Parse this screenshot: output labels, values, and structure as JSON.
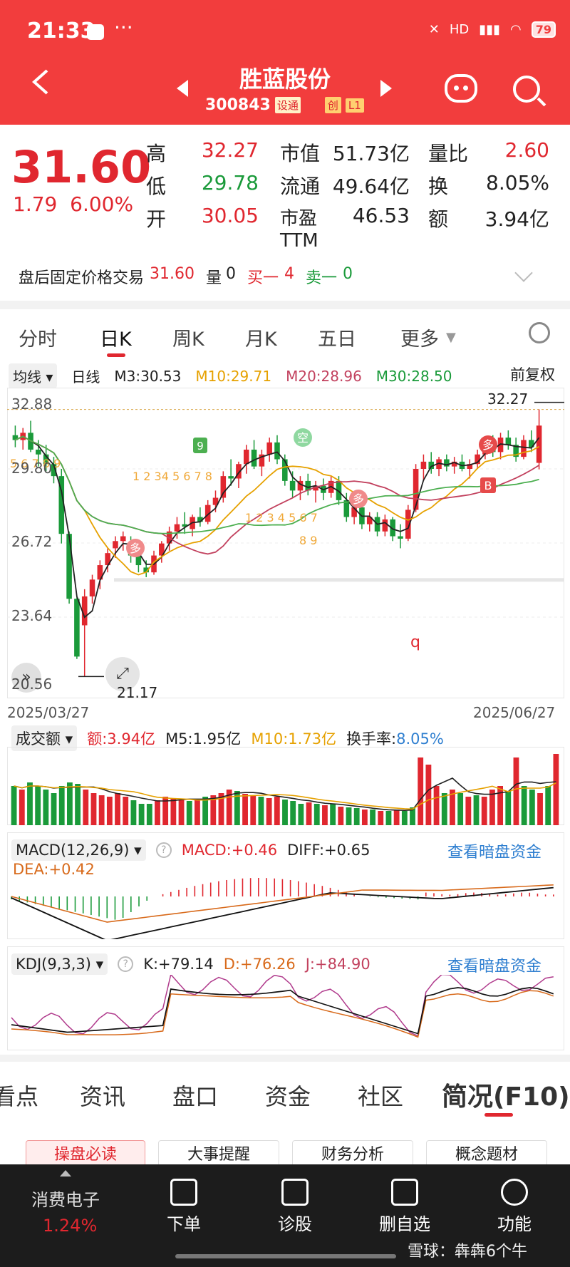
{
  "status_bar": {
    "time": "21:33",
    "dots": "···",
    "network": "HD",
    "battery": "79"
  },
  "header": {
    "stock_name": "胜蓝股份",
    "code": "300843",
    "tag1": "设通",
    "tag2": "创",
    "tag3": "L1"
  },
  "quote": {
    "price": "31.60",
    "change": "1.79",
    "change_pct": "6.00%",
    "rows": [
      {
        "l1": "高",
        "v1": "32.27",
        "l2": "市值",
        "v2": "51.73亿",
        "l3": "量比",
        "v3": "2.60"
      },
      {
        "l1": "低",
        "v1": "29.78",
        "l2": "流通",
        "v2": "49.64亿",
        "l3": "换",
        "v3": "8.05%"
      },
      {
        "l1": "开",
        "v1": "30.05",
        "l2": "市盈TTM",
        "v2": "46.53",
        "l3": "额",
        "v3": "3.94亿"
      }
    ],
    "after_hours": {
      "label": "盘后固定价格交易",
      "price": "31.60",
      "vol_label": "量",
      "vol": "0",
      "buy_label": "买一",
      "buy": "4",
      "sell_label": "卖一",
      "sell": "0"
    }
  },
  "chart_tabs": [
    "分时",
    "日K",
    "周K",
    "月K",
    "五日",
    "更多"
  ],
  "ma": {
    "chip": "均线",
    "type": "日线",
    "m3": "M3:30.53",
    "m10": "M10:29.71",
    "m20": "M20:28.96",
    "m30": "M30:28.50",
    "adjust": "前复权"
  },
  "kline": {
    "y_labels": [
      "32.88",
      "29.80",
      "26.72",
      "23.64",
      "20.56"
    ],
    "high_note": "32.27",
    "low_note": "21.17",
    "date_start": "2025/03/27",
    "date_end": "2025/06/27",
    "signals": [
      "多",
      "空",
      "多",
      "多",
      "B",
      "9",
      "q"
    ],
    "seq_a": "1 2 34 5 6 7 8",
    "seq_b": "1 2 3 4 5 6 7",
    "seq_c": "5 6 7 8 9",
    "seq_d": "8 9"
  },
  "volume": {
    "chip": "成交额",
    "amount": "额:3.94亿",
    "m5": "M5:1.95亿",
    "m10": "M10:1.73亿",
    "turnover_label": "换手率:",
    "turnover": "8.05%"
  },
  "macd": {
    "chip": "MACD(12,26,9)",
    "macd": "MACD:+0.46",
    "diff": "DIFF:+0.65",
    "dea": "DEA:+0.42",
    "link": "查看暗盘资金"
  },
  "kdj": {
    "chip": "KDJ(9,3,3)",
    "k": "K:+79.14",
    "d": "D:+76.26",
    "j": "J:+84.90",
    "link": "查看暗盘资金"
  },
  "info_tabs": [
    "看点",
    "资讯",
    "盘口",
    "资金",
    "社区",
    "简况(F10)"
  ],
  "pills": [
    "操盘必读",
    "大事提醒",
    "财务分析",
    "概念题材"
  ],
  "bottom_nav": {
    "sector": "消费电子",
    "sector_pct": "1.24%",
    "items": [
      "下单",
      "诊股",
      "删自选",
      "功能"
    ],
    "watermark": "雪球：犇犇6个牛"
  },
  "chart_data": [
    {
      "type": "candlestick",
      "x_range": [
        "2025/03/27",
        "2025/06/27"
      ],
      "ylim": [
        20.56,
        32.88
      ],
      "y_ticks": [
        32.88,
        29.8,
        26.72,
        23.64,
        20.56
      ],
      "candles": [
        [
          31.2,
          31.6,
          30.7,
          31.0
        ],
        [
          31.0,
          31.5,
          30.6,
          31.3
        ],
        [
          31.3,
          31.8,
          30.5,
          30.6
        ],
        [
          30.6,
          31.0,
          29.9,
          30.4
        ],
        [
          30.4,
          30.8,
          29.7,
          30.0
        ],
        [
          30.0,
          30.3,
          29.2,
          29.5
        ],
        [
          29.5,
          29.8,
          26.7,
          27.1
        ],
        [
          27.1,
          27.2,
          24.2,
          24.4
        ],
        [
          24.4,
          24.5,
          21.9,
          22.0
        ],
        [
          23.3,
          24.8,
          21.17,
          24.5
        ],
        [
          24.5,
          25.4,
          24.2,
          25.2
        ],
        [
          25.2,
          26.0,
          24.8,
          25.8
        ],
        [
          25.8,
          26.5,
          25.5,
          26.3
        ],
        [
          26.5,
          27.0,
          26.1,
          26.8
        ],
        [
          26.8,
          27.2,
          26.4,
          27.0
        ],
        [
          26.7,
          27.0,
          25.9,
          26.2
        ],
        [
          26.2,
          26.5,
          25.5,
          25.8
        ],
        [
          25.7,
          26.0,
          25.3,
          25.5
        ],
        [
          25.5,
          26.4,
          25.4,
          26.2
        ],
        [
          26.2,
          26.8,
          25.9,
          26.7
        ],
        [
          26.7,
          27.4,
          26.4,
          27.2
        ],
        [
          27.2,
          27.8,
          26.9,
          27.5
        ],
        [
          27.5,
          28.0,
          27.1,
          27.4
        ],
        [
          27.3,
          27.9,
          27.0,
          27.8
        ],
        [
          27.8,
          28.2,
          27.4,
          27.6
        ],
        [
          27.6,
          28.5,
          27.5,
          28.3
        ],
        [
          28.3,
          28.9,
          28.0,
          28.6
        ],
        [
          28.6,
          29.7,
          28.4,
          29.5
        ],
        [
          29.5,
          30.2,
          29.1,
          29.4
        ],
        [
          29.4,
          30.1,
          29.0,
          30.0
        ],
        [
          30.0,
          30.8,
          29.6,
          30.6
        ],
        [
          30.6,
          31.0,
          29.8,
          29.9
        ],
        [
          29.9,
          30.6,
          29.5,
          30.4
        ],
        [
          30.4,
          31.1,
          30.1,
          30.9
        ],
        [
          30.9,
          31.2,
          30.0,
          30.2
        ],
        [
          30.2,
          30.4,
          29.1,
          29.3
        ],
        [
          29.3,
          29.7,
          28.6,
          28.9
        ],
        [
          28.9,
          29.5,
          28.5,
          29.3
        ],
        [
          29.3,
          29.6,
          28.7,
          28.9
        ],
        [
          28.9,
          29.3,
          28.4,
          29.1
        ],
        [
          29.1,
          29.4,
          28.5,
          28.8
        ],
        [
          28.8,
          29.5,
          28.6,
          29.3
        ],
        [
          29.3,
          29.5,
          28.3,
          28.5
        ],
        [
          28.5,
          28.8,
          27.6,
          27.8
        ],
        [
          27.8,
          28.4,
          27.5,
          28.2
        ],
        [
          28.2,
          28.3,
          27.3,
          27.5
        ],
        [
          27.5,
          28.0,
          27.2,
          27.8
        ],
        [
          27.8,
          28.0,
          27.0,
          27.2
        ],
        [
          27.2,
          27.9,
          27.0,
          27.7
        ],
        [
          27.7,
          27.8,
          26.8,
          27.0
        ],
        [
          27.0,
          27.5,
          26.5,
          26.9
        ],
        [
          26.9,
          28.3,
          26.8,
          28.1
        ],
        [
          28.1,
          30.0,
          28.0,
          29.8
        ],
        [
          29.8,
          30.4,
          29.3,
          30.1
        ],
        [
          30.1,
          30.5,
          29.6,
          29.8
        ],
        [
          29.8,
          30.3,
          29.5,
          30.2
        ],
        [
          30.2,
          30.4,
          29.7,
          29.9
        ],
        [
          29.9,
          30.3,
          29.6,
          30.1
        ],
        [
          30.1,
          30.4,
          29.7,
          29.8
        ],
        [
          29.8,
          30.2,
          29.4,
          30.0
        ],
        [
          30.0,
          30.6,
          29.8,
          30.4
        ],
        [
          30.4,
          31.0,
          30.2,
          30.9
        ],
        [
          30.9,
          31.2,
          30.3,
          30.5
        ],
        [
          30.5,
          31.3,
          30.2,
          31.1
        ],
        [
          31.1,
          31.4,
          30.6,
          30.8
        ],
        [
          30.8,
          31.1,
          30.1,
          30.3
        ],
        [
          30.3,
          31.2,
          30.2,
          31.0
        ],
        [
          31.0,
          31.4,
          30.5,
          30.7
        ],
        [
          30.05,
          32.27,
          29.78,
          31.6
        ]
      ],
      "ma": [
        {
          "name": "M3",
          "value": 30.53
        },
        {
          "name": "M10",
          "value": 29.71
        },
        {
          "name": "M20",
          "value": 28.96
        },
        {
          "name": "M30",
          "value": 28.5
        }
      ],
      "annotations": [
        "32.27",
        "21.17"
      ]
    },
    {
      "type": "bar",
      "volume_relative": [
        0.55,
        0.5,
        0.6,
        0.55,
        0.5,
        0.45,
        0.55,
        0.6,
        0.58,
        0.5,
        0.45,
        0.42,
        0.4,
        0.45,
        0.4,
        0.35,
        0.3,
        0.3,
        0.35,
        0.4,
        0.38,
        0.36,
        0.34,
        0.35,
        0.4,
        0.42,
        0.45,
        0.5,
        0.48,
        0.44,
        0.42,
        0.4,
        0.38,
        0.4,
        0.36,
        0.34,
        0.3,
        0.32,
        0.3,
        0.28,
        0.3,
        0.26,
        0.25,
        0.24,
        0.22,
        0.22,
        0.2,
        0.2,
        0.22,
        0.2,
        0.25,
        0.95,
        0.85,
        0.55,
        0.45,
        0.5,
        0.45,
        0.4,
        0.42,
        0.4,
        0.5,
        0.55,
        0.48,
        0.95,
        0.55,
        0.5,
        0.45,
        0.55,
        1.0
      ],
      "up": [
        0,
        1,
        0,
        0,
        0,
        0,
        0,
        0,
        0,
        1,
        1,
        1,
        1,
        1,
        1,
        0,
        0,
        0,
        1,
        1,
        1,
        1,
        0,
        1,
        0,
        1,
        1,
        1,
        0,
        1,
        1,
        0,
        1,
        1,
        0,
        0,
        0,
        1,
        0,
        1,
        0,
        1,
        0,
        0,
        1,
        0,
        1,
        0,
        1,
        0,
        0,
        1,
        1,
        1,
        0,
        1,
        0,
        1,
        0,
        1,
        1,
        1,
        0,
        1,
        0,
        0,
        1,
        0,
        1
      ],
      "values": [
        {
          "name": "额",
          "value": "3.94亿"
        },
        {
          "name": "M5",
          "value": "1.95亿"
        },
        {
          "name": "M10",
          "value": "1.73亿"
        }
      ]
    },
    {
      "type": "macd",
      "macd": 0.46,
      "diff": 0.65,
      "dea": 0.42
    },
    {
      "type": "kdj",
      "k": 79.14,
      "d": 76.26,
      "j": 84.9
    }
  ]
}
